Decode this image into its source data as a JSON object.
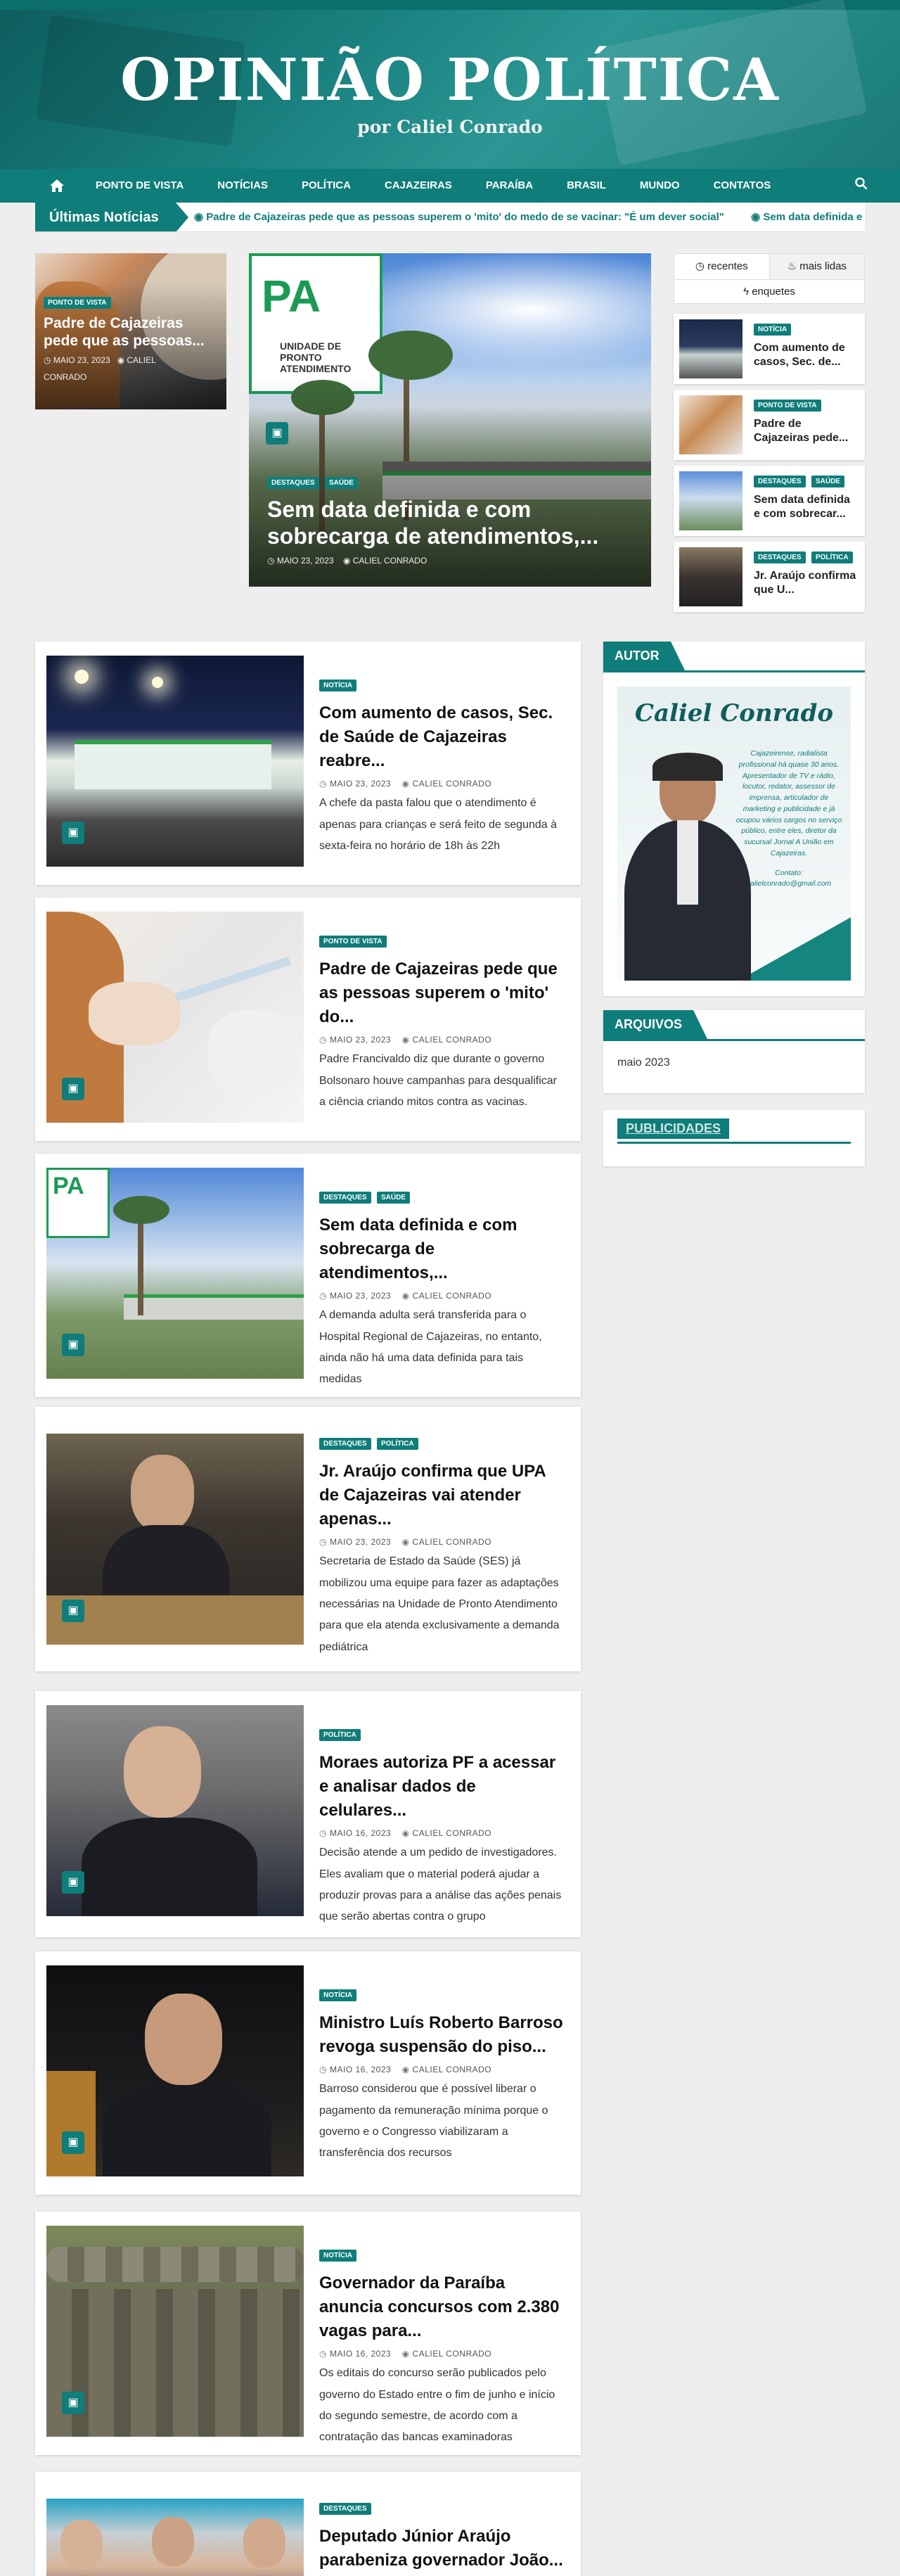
{
  "site": {
    "title": "OPINIÃO POLÍTICA",
    "subtitle": "por Caliel Conrado"
  },
  "nav": {
    "home_icon": "home-icon",
    "items": [
      "PONTO DE VISTA",
      "NOTÍCIAS",
      "POLÍTICA",
      "CAJAZEIRAS",
      "PARAÍBA",
      "BRASIL",
      "MUNDO",
      "CONTATOS"
    ],
    "search_icon": "search-icon"
  },
  "ticker": {
    "label": "Últimas Notícias",
    "items": [
      "Padre de Cajazeiras pede que as pessoas superem o 'mito' do medo de se vacinar: \"É um dever social\"",
      "Sem data definida e co"
    ]
  },
  "featured": {
    "small": {
      "badge": "PONTO DE VISTA",
      "title": "Padre de Cajazeiras pede que as pessoas...",
      "date": "MAIO 23, 2023",
      "author_line1": "CALIEL",
      "author_line2": "CONRADO"
    },
    "big": {
      "badges": [
        "DESTAQUES",
        "SAÚDE"
      ],
      "title": "Sem data definida e com sobrecarga de atendimentos,...",
      "date": "MAIO 23, 2023",
      "author": "CALIEL CONRADO",
      "sign_text": "PA",
      "sign_sub": "UNIDADE DE PRONTO ATENDIMENTO"
    }
  },
  "tabs": {
    "recentes": "recentes",
    "mais_lidas": "mais lidas",
    "enquetes": "enquetes",
    "posts": [
      {
        "badges": [
          "NOTÍCIA"
        ],
        "title": "Com aumento de casos, Sec. de..."
      },
      {
        "badges": [
          "PONTO DE VISTA"
        ],
        "title": "Padre de Cajazeiras pede..."
      },
      {
        "badges": [
          "DESTAQUES",
          "SAÚDE"
        ],
        "title": "Sem data definida e com sobrecar..."
      },
      {
        "badges": [
          "DESTAQUES",
          "POLÍTICA"
        ],
        "title": "Jr. Araújo confirma que U..."
      }
    ]
  },
  "posts": [
    {
      "badges": [
        "NOTÍCIA"
      ],
      "title": "Com aumento de casos, Sec. de Saúde de Cajazeiras reabre...",
      "date": "MAIO 23, 2023",
      "author": "CALIEL CONRADO",
      "excerpt": "A chefe da pasta falou que o atendimento é apenas para crianças e será feito de segunda à sexta-feira no horário de 18h às 22h"
    },
    {
      "badges": [
        "PONTO DE VISTA"
      ],
      "title": "Padre de Cajazeiras pede que as pessoas superem o 'mito' do...",
      "date": "MAIO 23, 2023",
      "author": "CALIEL CONRADO",
      "excerpt": "Padre Francivaldo diz que durante o governo Bolsonaro houve campanhas para desqualificar a ciência criando mitos contra as vacinas."
    },
    {
      "badges": [
        "DESTAQUES",
        "SAÚDE"
      ],
      "title": "Sem data definida e com sobrecarga de atendimentos,...",
      "date": "MAIO 23, 2023",
      "author": "CALIEL CONRADO",
      "excerpt": "A demanda adulta será transferida para o Hospital Regional de Cajazeiras, no entanto, ainda não há uma data definida para tais medidas"
    },
    {
      "badges": [
        "DESTAQUES",
        "POLÍTICA"
      ],
      "title": "Jr. Araújo confirma que UPA de Cajazeiras vai atender apenas...",
      "date": "MAIO 23, 2023",
      "author": "CALIEL CONRADO",
      "excerpt": "Secretaria de Estado da Saúde (SES) já mobilizou uma equipe para fazer as adaptações necessárias na Unidade de Pronto Atendimento para que ela atenda exclusivamente a demanda pediátrica"
    },
    {
      "badges": [
        "POLÍTICA"
      ],
      "title": "Moraes autoriza PF a acessar e analisar dados de celulares...",
      "date": "MAIO 16, 2023",
      "author": "CALIEL CONRADO",
      "excerpt": "Decisão atende a um pedido de investigadores. Eles avaliam que o material poderá ajudar a produzir provas para a análise das ações penais que serão abertas contra o grupo"
    },
    {
      "badges": [
        "NOTÍCIA"
      ],
      "title": "Ministro Luís Roberto Barroso revoga suspensão do piso...",
      "date": "MAIO 16, 2023",
      "author": "CALIEL CONRADO",
      "excerpt": "Barroso considerou que é possível liberar o pagamento da remuneração mínima porque o governo e o Congresso viabilizaram a transferência dos recursos"
    },
    {
      "badges": [
        "NOTÍCIA"
      ],
      "title": "Governador da Paraíba anuncia concursos com 2.380 vagas para...",
      "date": "MAIO 16, 2023",
      "author": "CALIEL CONRADO",
      "excerpt": "Os editais do concurso serão publicados pelo governo do Estado entre o fim de junho e início do segundo semestre, de acordo com a contratação das bancas examinadoras"
    },
    {
      "badges": [
        "DESTAQUES"
      ],
      "title": "Deputado Júnior Araújo parabeniza governador João...",
      "date": "",
      "author": "",
      "excerpt": ""
    }
  ],
  "sidebar": {
    "autor": {
      "heading": "AUTOR",
      "name": "Caliel Conrado",
      "bio": "Cajazeirense, radialista profissional há quase 30 anos. Apresentador de TV e rádio, locutor, redator, assessor de imprensa, articulador de marketing e publicidade e já ocupou vários cargos no serviço público, entre eles, diretor da sucursal Jornal A União em Cajazeiras.",
      "contact_label": "Contato:",
      "contact_email": "calielconrado@gmail.com"
    },
    "arquivos": {
      "heading": "ARQUIVOS",
      "items": [
        "maio 2023"
      ]
    },
    "publicidades": {
      "heading": "PUBLICIDADES"
    }
  },
  "colors": {
    "brand": "#0f7d79",
    "header_dark": "#0d5d5c"
  },
  "icons": {
    "camera": "camera-icon",
    "clock": "clock-icon",
    "user": "user-icon",
    "fire": "fire-icon",
    "bolt": "bolt-icon"
  }
}
